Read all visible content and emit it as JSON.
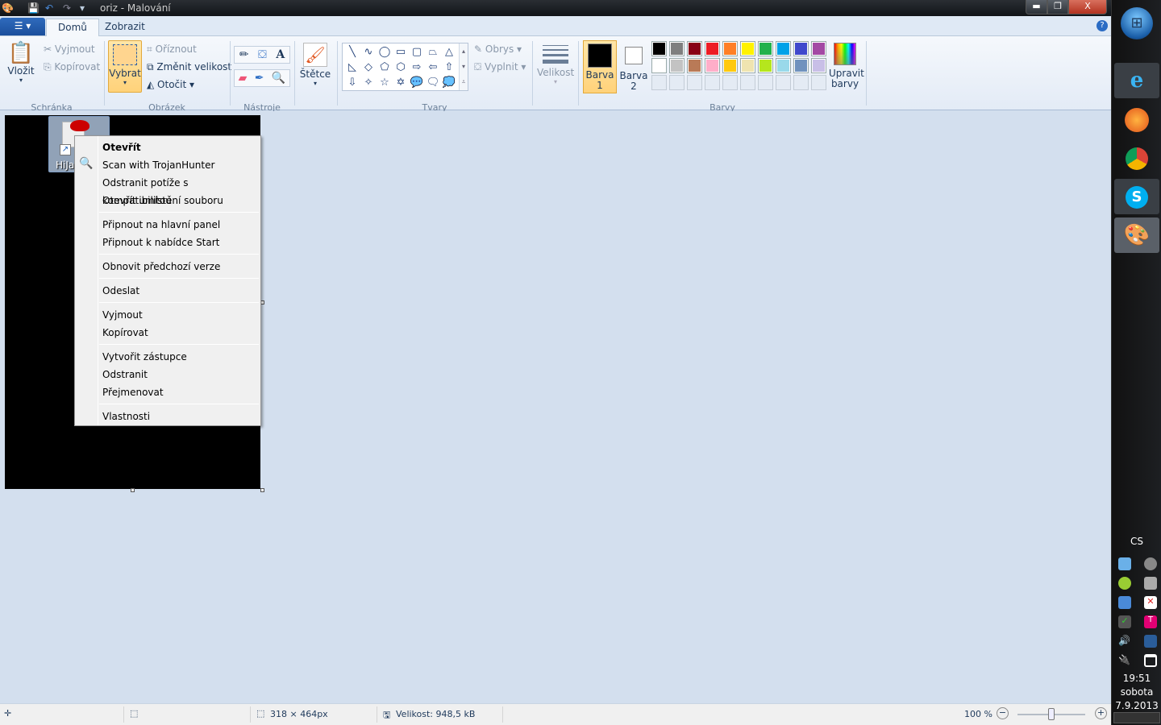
{
  "window": {
    "title": "oriz - Malování",
    "minimize": "▬",
    "restore": "❐",
    "close": "X"
  },
  "tabs": [
    {
      "label": "Domů",
      "active": true
    },
    {
      "label": "Zobrazit",
      "active": false
    }
  ],
  "ribbon": {
    "clipboard": {
      "paste": "Vložit",
      "cut": "Vyjmout",
      "copy": "Kopírovat",
      "group": "Schránka"
    },
    "image": {
      "select": "Vybrat",
      "crop": "Oříznout",
      "resize": "Změnit velikost",
      "rotate": "Otočit",
      "group": "Obrázek"
    },
    "tools": {
      "group": "Nástroje"
    },
    "brushes": {
      "label": "Štětce"
    },
    "shapes": {
      "outline": "Obrys",
      "fill": "Vyplnit",
      "group": "Tvary",
      "glyphs": [
        "╲",
        "∿",
        "◯",
        "▭",
        "▢",
        "⏢",
        "△",
        "◺",
        "◇",
        "⬠",
        "⬡",
        "⇨",
        "⇦",
        "⇧",
        "⇩",
        "✧",
        "☆",
        "✡",
        "💬",
        "🗨",
        "💭"
      ]
    },
    "size": {
      "label": "Velikost"
    },
    "colors": {
      "color1_label": "Barva",
      "color1_num": "1",
      "color2_label": "Barva",
      "color2_num": "2",
      "edit_line1": "Upravit",
      "edit_line2": "barvy",
      "group": "Barvy",
      "color1": "#000000",
      "color2": "#ffffff",
      "row1": [
        "#000000",
        "#7f7f7f",
        "#880015",
        "#ed1c24",
        "#ff7f27",
        "#fff200",
        "#22b14c",
        "#00a2e8",
        "#3f48cc",
        "#a349a4"
      ],
      "row2": [
        "#ffffff",
        "#c3c3c3",
        "#b97a57",
        "#ffaec9",
        "#ffc90e",
        "#efe4b0",
        "#b5e61d",
        "#99d9ea",
        "#7092be",
        "#c8bfe7"
      ]
    }
  },
  "desktop_icon": {
    "label": "HiJa"
  },
  "context_menu": {
    "groups": [
      [
        "Otevřít",
        "Scan with TrojanHunter",
        "Odstranit potíže s kompatibilitou",
        "Otevřít umístění souboru"
      ],
      [
        "Připnout na hlavní panel",
        "Připnout k nabídce Start"
      ],
      [
        "Obnovit předchozí verze"
      ],
      [
        "Odeslat"
      ],
      [
        "Vyjmout",
        "Kopírovat"
      ],
      [
        "Vytvořit zástupce",
        "Odstranit",
        "Přejmenovat"
      ],
      [
        "Vlastnosti"
      ]
    ]
  },
  "status": {
    "dimensions": "318 × 464px",
    "file_size": "Velikost: 948,5 kB",
    "zoom": "100 %",
    "zoom_level": 100
  },
  "taskbar": {
    "language": "CS",
    "time": "19:51",
    "day": "sobota",
    "date": "7.9.2013"
  }
}
